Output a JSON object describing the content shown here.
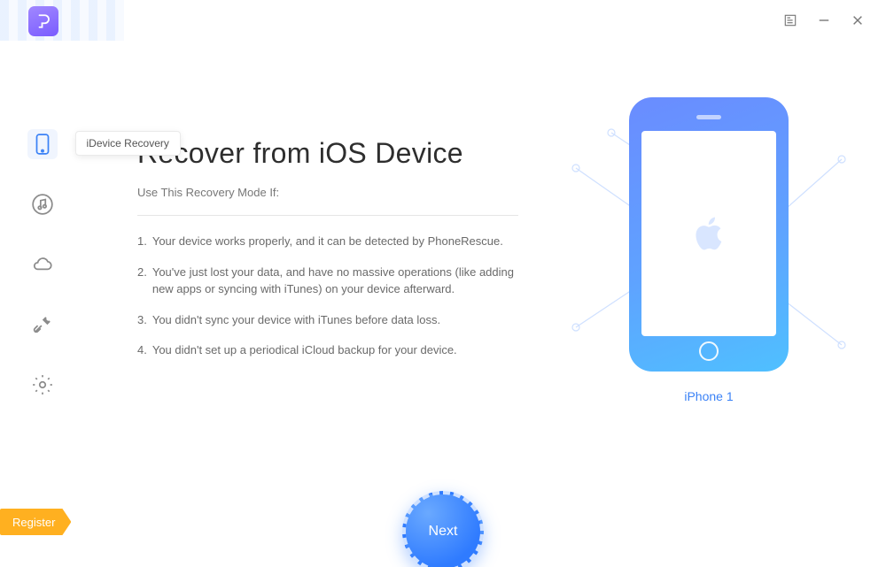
{
  "window": {
    "min_label": "Minimize",
    "close_label": "Close",
    "menu_label": "Menu"
  },
  "sidebar": {
    "items": [
      {
        "name": "idevice-recovery",
        "tooltip": "iDevice Recovery",
        "active": true
      },
      {
        "name": "itunes-recovery"
      },
      {
        "name": "icloud-recovery"
      },
      {
        "name": "tools"
      },
      {
        "name": "settings"
      }
    ]
  },
  "page": {
    "title": "Recover from iOS Device",
    "subtitle": "Use This Recovery Mode If:",
    "conditions": [
      "Your device works properly, and it can be detected by PhoneRescue.",
      "You've just lost your data, and have no massive operations (like adding new apps or syncing with iTunes) on your device afterward.",
      "You didn't sync your device with iTunes before data loss.",
      "You didn't set up a periodical iCloud backup for your device."
    ]
  },
  "device": {
    "name": "iPhone 1"
  },
  "actions": {
    "next": "Next",
    "register": "Register"
  }
}
